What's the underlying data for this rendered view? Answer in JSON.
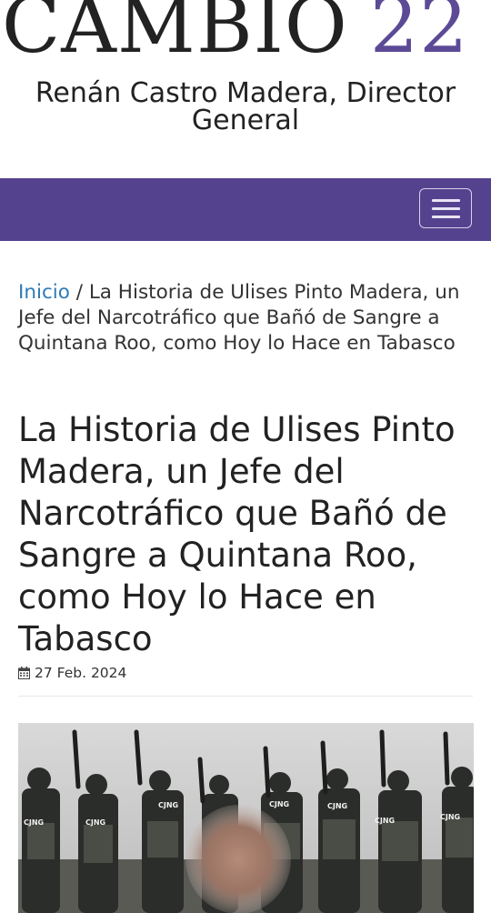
{
  "site": {
    "logo_word": "CAMBIO",
    "logo_number": "22",
    "director_line": "Renán Castro Madera, Director General"
  },
  "nav": {
    "menu_icon": "hamburger-menu-icon"
  },
  "breadcrumb": {
    "home_label": "Inicio",
    "separator": " / ",
    "current": "La Historia de Ulises Pinto Madera, un Jefe del Narcotráfico que Bañó de Sangre a Quintana Roo, como Hoy lo Hace en Tabasco"
  },
  "article": {
    "title": "La Historia de Ulises Pinto Madera, un Jefe del Narcotráfico que Bañó de Sangre a Quintana Roo, como Hoy lo Hace en Tabasco",
    "date": "27 Feb. 2024",
    "date_icon": "calendar-icon",
    "image_labels": [
      "CJNG",
      "CJNG",
      "CJNG",
      "CJNG",
      "CJNG",
      "CJNG",
      "CJNG"
    ]
  },
  "colors": {
    "brand_purple": "#55428f",
    "logo_number": "#5c4a96",
    "link_blue": "#2f7ab8",
    "text_dark": "#222222"
  }
}
